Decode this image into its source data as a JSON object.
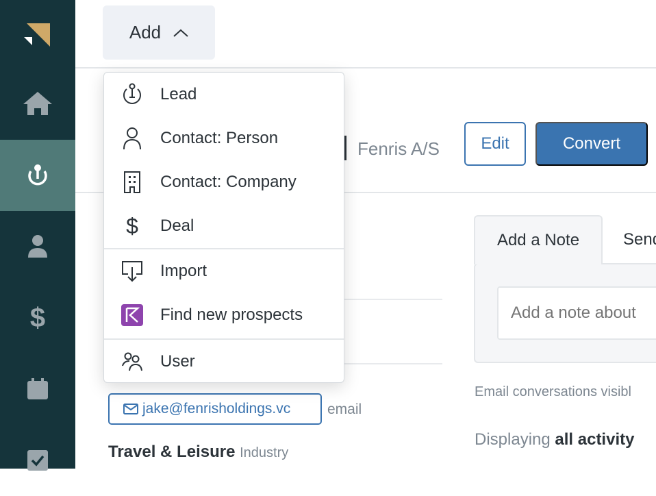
{
  "sidebar": {
    "items": [
      {
        "icon": "logo"
      },
      {
        "icon": "home-icon"
      },
      {
        "icon": "lead-icon",
        "active": true
      },
      {
        "icon": "person-icon"
      },
      {
        "icon": "dollar-icon"
      },
      {
        "icon": "calendar-icon"
      },
      {
        "icon": "check-icon"
      }
    ]
  },
  "topbar": {
    "add_label": "Add"
  },
  "add_menu": {
    "items": [
      {
        "label": "Lead",
        "icon": "lead-icon"
      },
      {
        "label": "Contact: Person",
        "icon": "person-icon"
      },
      {
        "label": "Contact: Company",
        "icon": "building-icon"
      },
      {
        "label": "Deal",
        "icon": "dollar-icon"
      },
      {
        "label": "Import",
        "icon": "import-icon"
      },
      {
        "label": "Find new prospects",
        "icon": "prospects-icon"
      },
      {
        "label": "User",
        "icon": "users-icon"
      }
    ]
  },
  "lead": {
    "company": "Fenris A/S",
    "edit_label": "Edit",
    "convert_label": "Convert",
    "email": "jake@fenrisholdings.vc",
    "email_label": "email",
    "industry": "Travel & Leisure",
    "industry_label": "Industry"
  },
  "activity": {
    "tabs": [
      "Add a Note",
      "Send"
    ],
    "note_placeholder": "Add a note about",
    "email_notice": "Email conversations visibl",
    "displaying_prefix": "Displaying",
    "displaying_value": "all activity"
  },
  "colors": {
    "sidebar": "#15343b",
    "sidebar_active": "#507a78",
    "primary": "#3a74b0",
    "logo": "#cfa968",
    "prospects": "#8e44ad"
  }
}
